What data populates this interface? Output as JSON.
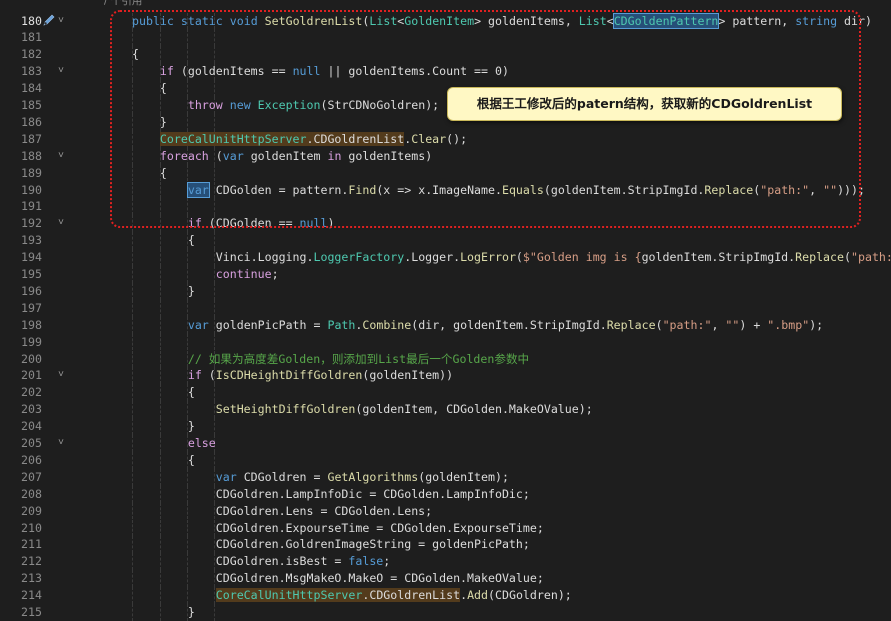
{
  "top_comment": "/ 个引用",
  "callout_text": "根据王工修改后的patern结构，获取新的CDGoldrenList",
  "lines": [
    {
      "n": "180",
      "fold": true,
      "html": "<span class=\"kw\">public</span> <span class=\"kw\">static</span> <span class=\"kw\">void</span> <span class=\"mt\">SetGoldrenList</span>(<span class=\"ty\">List</span>&lt;<span class=\"ty\">GoldenItem</span>&gt; goldenItems, <span class=\"ty\">List</span>&lt;<span class=\"ty sel\">CDGoldenPattern</span>&gt; pattern, <span class=\"kw\">string</span> dir)"
    },
    {
      "n": "181",
      "fold": false,
      "html": ""
    },
    {
      "n": "182",
      "fold": false,
      "html": "{"
    },
    {
      "n": "183",
      "fold": true,
      "html": "    <span class=\"ctl\">if</span> (goldenItems == <span class=\"kw\">null</span> || goldenItems.Count == 0)"
    },
    {
      "n": "184",
      "fold": false,
      "html": "    {"
    },
    {
      "n": "185",
      "fold": false,
      "html": "        <span class=\"ctl\">throw</span> <span class=\"kw\">new</span> <span class=\"ty\">Exception</span>(StrCDNoGoldren);"
    },
    {
      "n": "186",
      "fold": false,
      "html": "    }"
    },
    {
      "n": "187",
      "fold": false,
      "html": "    <span class=\"ty hl\">CoreCalUnitHttpServer</span><span class=\"hl\">.CDGoldrenList</span>.<span class=\"mt\">Clear</span>();"
    },
    {
      "n": "188",
      "fold": true,
      "html": "    <span class=\"ctl\">foreach</span> (<span class=\"kw\">var</span> goldenItem <span class=\"ctl\">in</span> goldenItems)"
    },
    {
      "n": "189",
      "fold": false,
      "html": "    {"
    },
    {
      "n": "190",
      "fold": false,
      "html": "        <span class=\"kw sel\">var</span> CDGolden = pattern.<span class=\"mt\">Find</span>(x =&gt; x.ImageName.<span class=\"mt\">Equals</span>(goldenItem.StripImgId.<span class=\"mt\">Replace</span>(<span class=\"st\">\"path:\"</span>, <span class=\"st\">\"\"</span>)));"
    },
    {
      "n": "191",
      "fold": false,
      "html": ""
    },
    {
      "n": "192",
      "fold": true,
      "html": "        <span class=\"ctl\">if</span> (CDGolden == <span class=\"kw\">null</span>)"
    },
    {
      "n": "193",
      "fold": false,
      "html": "        {"
    },
    {
      "n": "194",
      "fold": false,
      "html": "            Vinci.Logging.<span class=\"ty\">LoggerFactory</span>.Logger.<span class=\"mt\">LogError</span>(<span class=\"st\">$\"Golden img is {</span>goldenItem.StripImgId.<span class=\"mt\">Replace</span>(<span class=\"st\">\"path:\"</span>,"
    },
    {
      "n": "195",
      "fold": false,
      "html": "            <span class=\"ctl\">continue</span>;"
    },
    {
      "n": "196",
      "fold": false,
      "html": "        }"
    },
    {
      "n": "197",
      "fold": false,
      "html": ""
    },
    {
      "n": "198",
      "fold": false,
      "html": "        <span class=\"kw\">var</span> goldenPicPath = <span class=\"ty\">Path</span>.<span class=\"mt\">Combine</span>(dir, goldenItem.StripImgId.<span class=\"mt\">Replace</span>(<span class=\"st\">\"path:\"</span>, <span class=\"st\">\"\"</span>) + <span class=\"st\">\".bmp\"</span>);"
    },
    {
      "n": "199",
      "fold": false,
      "html": ""
    },
    {
      "n": "200",
      "fold": false,
      "html": "        <span class=\"cm\">// 如果为高度差Golden，则添加到List最后一个Golden参数中</span>"
    },
    {
      "n": "201",
      "fold": true,
      "html": "        <span class=\"ctl\">if</span> (<span class=\"mt\">IsCDHeightDiffGoldren</span>(goldenItem))"
    },
    {
      "n": "202",
      "fold": false,
      "html": "        {"
    },
    {
      "n": "203",
      "fold": false,
      "html": "            <span class=\"mt\">SetHeightDiffGoldren</span>(goldenItem, CDGolden.MakeOValue);"
    },
    {
      "n": "204",
      "fold": false,
      "html": "        }"
    },
    {
      "n": "205",
      "fold": true,
      "html": "        <span class=\"ctl\">else</span>"
    },
    {
      "n": "206",
      "fold": false,
      "html": "        {"
    },
    {
      "n": "207",
      "fold": false,
      "html": "            <span class=\"kw\">var</span> CDGoldren = <span class=\"mt\">GetAlgorithms</span>(goldenItem);"
    },
    {
      "n": "208",
      "fold": false,
      "html": "            CDGoldren.LampInfoDic = CDGolden.LampInfoDic;"
    },
    {
      "n": "209",
      "fold": false,
      "html": "            CDGoldren.Lens = CDGolden.Lens;"
    },
    {
      "n": "210",
      "fold": false,
      "html": "            CDGoldren.ExpourseTime = CDGolden.ExpourseTime;"
    },
    {
      "n": "211",
      "fold": false,
      "html": "            CDGoldren.GoldrenImageString = goldenPicPath;"
    },
    {
      "n": "212",
      "fold": false,
      "html": "            CDGoldren.isBest = <span class=\"kw\">false</span>;"
    },
    {
      "n": "213",
      "fold": false,
      "html": "            CDGoldren.MsgMakeO.MakeO = CDGolden.MakeOValue;"
    },
    {
      "n": "214",
      "fold": false,
      "html": "            <span class=\"ty hl\">CoreCalUnitHttpServer</span><span class=\"hl\">.CDGoldrenList</span>.<span class=\"mt\">Add</span>(CDGoldren);"
    },
    {
      "n": "215",
      "fold": false,
      "html": "        }"
    }
  ]
}
